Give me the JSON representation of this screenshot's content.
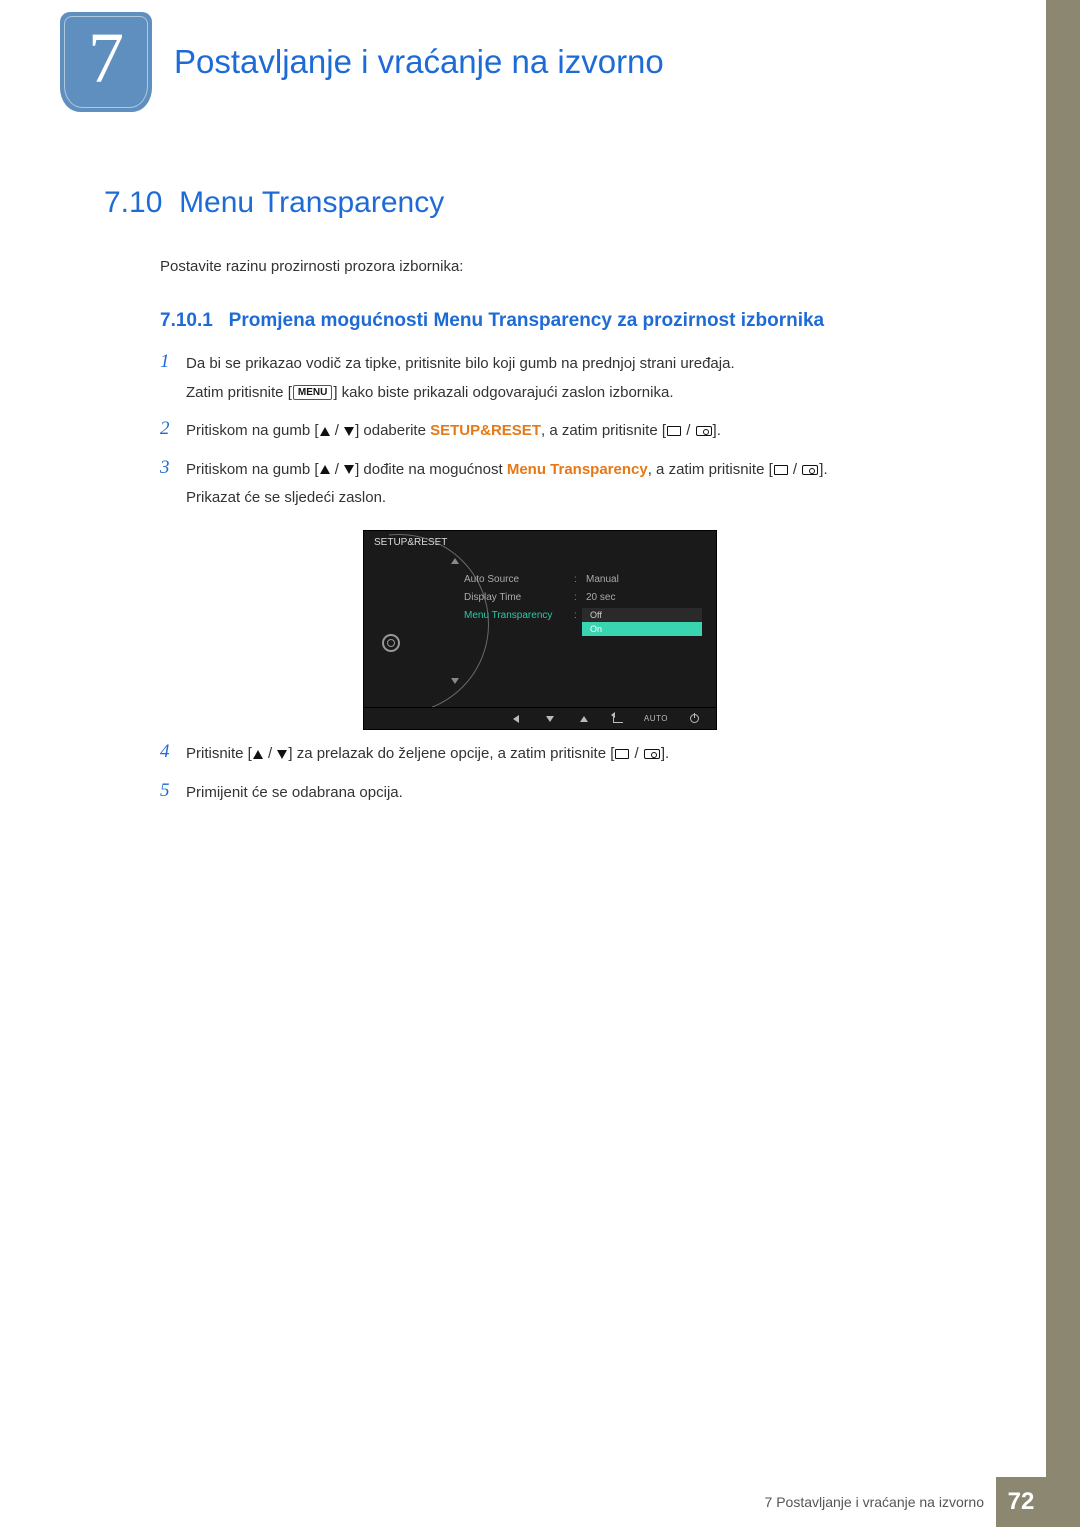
{
  "chapter": {
    "number": "7",
    "title": "Postavljanje i vraćanje na izvorno"
  },
  "section": {
    "number": "7.10",
    "title": "Menu Transparency"
  },
  "intro": "Postavite razinu prozirnosti prozora izbornika:",
  "subsection": {
    "number": "7.10.1",
    "title": "Promjena mogućnosti Menu Transparency za prozirnost izbornika"
  },
  "steps": {
    "s1_a": "Da bi se prikazao vodič za tipke, pritisnite bilo koji gumb na prednjoj strani uređaja.",
    "s1_b_pre": "Zatim pritisnite [",
    "s1_b_key": "MENU",
    "s1_b_post": "] kako biste prikazali odgovarajući zaslon izbornika.",
    "s2_pre": "Pritiskom na gumb [",
    "s2_mid": "] odaberite ",
    "s2_bold": "SETUP&RESET",
    "s2_post": ", a zatim pritisnite [",
    "s2_end": "].",
    "s3_pre": "Pritiskom na gumb [",
    "s3_mid": "] dođite na mogućnost ",
    "s3_bold": "Menu Transparency",
    "s3_post": ", a zatim pritisnite [",
    "s3_end": "].",
    "s3_extra": "Prikazat će se sljedeći zaslon.",
    "s4_pre": "Pritisnite [",
    "s4_mid": "] za prelazak do željene opcije, a zatim pritisnite [",
    "s4_end": "].",
    "s5": "Primijenit će se odabrana opcija."
  },
  "osd": {
    "title": "SETUP&RESET",
    "rows": {
      "auto_source": {
        "label": "Auto Source",
        "value": "Manual"
      },
      "display_time": {
        "label": "Display Time",
        "value": "20 sec"
      },
      "menu_transparency": {
        "label": "Menu Transparency"
      }
    },
    "dropdown": {
      "off": "Off",
      "on": "On"
    },
    "footer_auto": "AUTO"
  },
  "footer": {
    "text": "7 Postavljanje i vraćanje na izvorno",
    "page": "72"
  }
}
